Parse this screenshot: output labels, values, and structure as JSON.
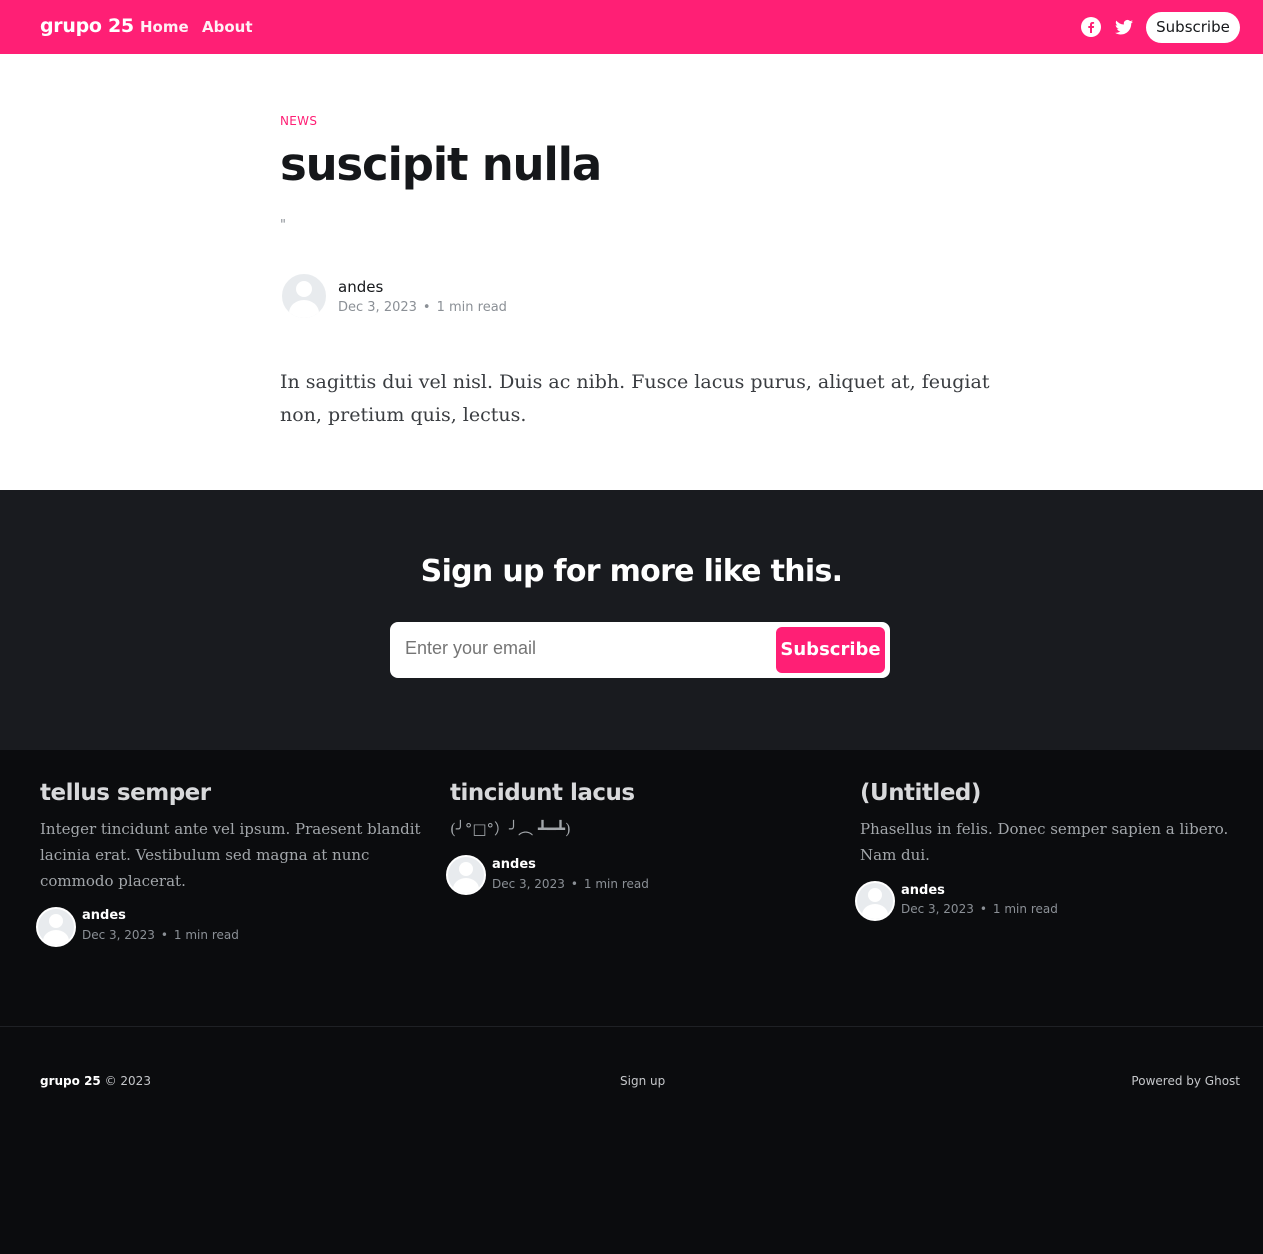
{
  "header": {
    "logo": "grupo 25",
    "nav": [
      {
        "label": "Home"
      },
      {
        "label": "About"
      }
    ],
    "subscribe_label": "Subscribe"
  },
  "article": {
    "tag": "NEWS",
    "title": "suscipit nulla",
    "excerpt": "\"",
    "author": "andes",
    "date": "Dec 3, 2023",
    "read_time": "1 min read",
    "body": "In sagittis dui vel nisl. Duis ac nibh. Fusce lacus purus, aliquet at, feugiat non, pretium quis, lectus."
  },
  "signup": {
    "title": "Sign up for more like this.",
    "placeholder": "Enter your email",
    "button_label": "Subscribe"
  },
  "related": [
    {
      "title": "tellus semper",
      "excerpt": "Integer tincidunt ante vel ipsum. Praesent blandit lacinia erat. Vestibulum sed magna at nunc commodo placerat.",
      "author": "andes",
      "date": "Dec 3, 2023",
      "read_time": "1 min read"
    },
    {
      "title": "tincidunt lacus",
      "excerpt": "(╯°□°）╯︵ ┻━┻)",
      "author": "andes",
      "date": "Dec 3, 2023",
      "read_time": "1 min read"
    },
    {
      "title": "(Untitled)",
      "excerpt": "Phasellus in felis. Donec semper sapien a libero. Nam dui.",
      "author": "andes",
      "date": "Dec 3, 2023",
      "read_time": "1 min read"
    }
  ],
  "footer": {
    "site_name": "grupo 25",
    "copyright": "© 2023",
    "signup_link": "Sign up",
    "powered_by": "Powered by Ghost"
  },
  "colors": {
    "accent": "#ff1f75",
    "dark": "#191b1f",
    "darker": "#0b0c0e"
  },
  "icons": [
    "facebook-icon",
    "twitter-icon",
    "avatar-placeholder-icon"
  ]
}
